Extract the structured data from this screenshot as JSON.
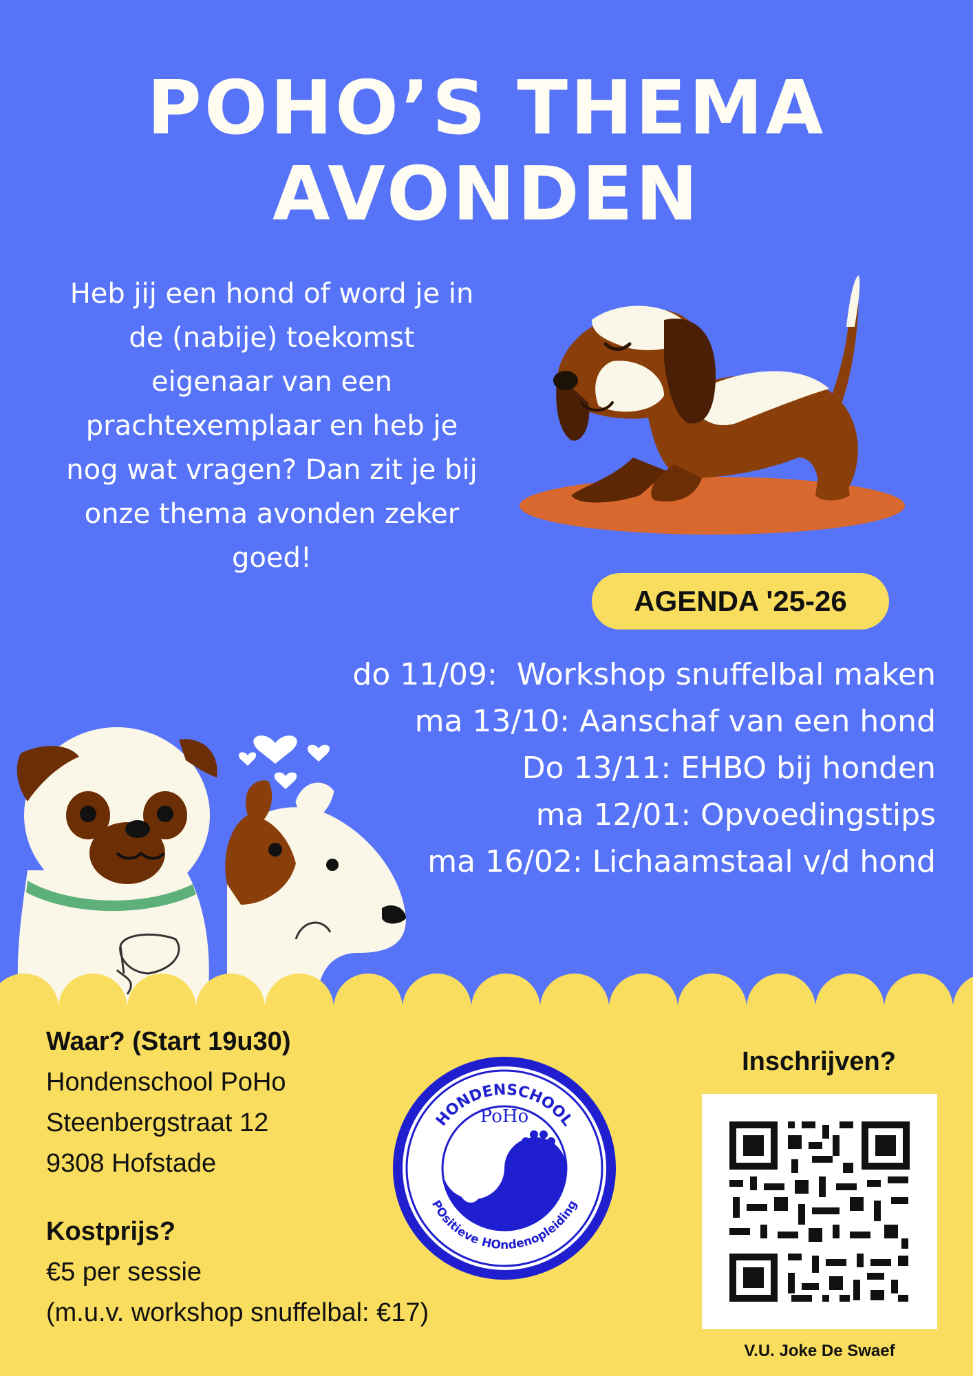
{
  "title": {
    "line1": "POHO’S THEMA",
    "line2": "AVONDEN"
  },
  "intro": "Heb jij een hond of word je in de (nabije) toekomst eigenaar van een prachtexemplaar en heb je nog wat vragen? Dan zit je bij onze thema avonden zeker goed!",
  "agenda": {
    "label": "AGENDA '25-26",
    "items": [
      "do 11/09:  Workshop snuffelbal maken",
      "ma 13/10: Aanschaf van een hond",
      "Do 13/11: EHBO bij honden",
      "ma 12/01: Opvoedingstips",
      "ma 16/02: Lichaamstaal v/d hond"
    ]
  },
  "location": {
    "heading": "Waar? (Start 19u30)",
    "line1": "Hondenschool PoHo",
    "line2": "Steenbergstraat 12",
    "line3": "9308 Hofstade"
  },
  "price": {
    "heading": "Kostprijs?",
    "line1": "€5 per sessie",
    "line2": "(m.u.v. workshop snuffelbal: €17)"
  },
  "logo": {
    "top_text": "HONDENSCHOOL",
    "name": "PoHo",
    "bottom_text": "POsitieve HOndenopleiding"
  },
  "signup": {
    "label": "Inschrijven?"
  },
  "footer_note": "V.U. Joke De Swaef",
  "colors": {
    "background": "#5774f8",
    "footer": "#f9dd5e",
    "logo_blue": "#1f1fd0"
  }
}
